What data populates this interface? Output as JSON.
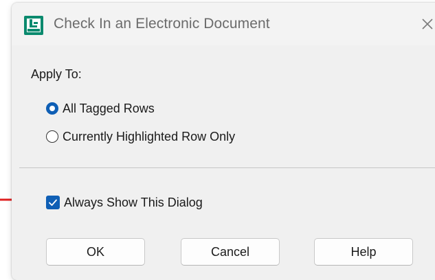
{
  "dialog": {
    "title": "Check In an Electronic Document",
    "close_glyph": "✕"
  },
  "apply_to": {
    "label": "Apply To:",
    "options": [
      {
        "label": "All Tagged Rows",
        "selected": true
      },
      {
        "label": "Currently Highlighted Row Only",
        "selected": false
      }
    ]
  },
  "always_show": {
    "label": "Always Show This Dialog",
    "checked": true
  },
  "buttons": {
    "ok": "OK",
    "cancel": "Cancel",
    "help": "Help"
  },
  "colors": {
    "accent": "#0f5fb5",
    "annotation_arrow": "#e02020",
    "title_text": "#6b6b6b"
  },
  "icons": {
    "app": "document-check-in-icon",
    "close": "close-icon",
    "checkmark": "checkmark-icon",
    "arrow": "annotation-arrow-icon"
  }
}
